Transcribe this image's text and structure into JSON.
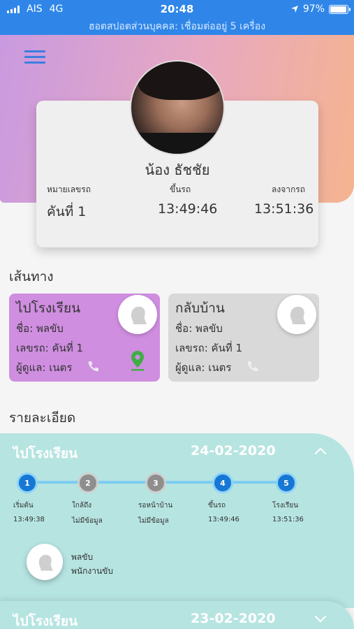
{
  "status": {
    "carrier": "AIS",
    "network": "4G",
    "time": "20:48",
    "battery": "97%",
    "battery_level": 0.97,
    "hotspot": "ฮอตสปอตส่วนบุคคล: เชื่อมต่ออยู่ 5 เครื่อง"
  },
  "profile": {
    "name": "น้อง ธัชชัย",
    "labels": {
      "bus_no": "หมายเลขรถ",
      "board": "ขึ้นรถ",
      "alight": "ลงจากรถ"
    },
    "values": {
      "bus_no": "คันที่ 1",
      "board": "13:49:46",
      "alight": "13:51:36"
    }
  },
  "routes_title": "เส้นทาง",
  "routes": [
    {
      "title": "ไปโรงเรียน",
      "name": "ชื่อ: พลขับ",
      "bus": "เลขรถ: คันที่ 1",
      "caretaker": "ผู้ดูแล: เนตร",
      "color": "#cf8ee0"
    },
    {
      "title": "กลับบ้าน",
      "name": "ชื่อ: พลขับ",
      "bus": "เลขรถ: คันที่ 1",
      "caretaker": "ผู้ดูแล: เนตร",
      "color": "#d9d9d9"
    }
  ],
  "details_title": "รายละเอียด",
  "detail": {
    "title": "ไปโรงเรียน",
    "date": "24-02-2020",
    "steps": [
      {
        "num": "1",
        "label": "เริ่มต้น",
        "time": "13:49:38",
        "state": "done"
      },
      {
        "num": "2",
        "label": "ใกล้ถึง",
        "time": "ไม่มีข้อมูล",
        "state": "none"
      },
      {
        "num": "3",
        "label": "รอหน้าบ้าน",
        "time": "ไม่มีข้อมูล",
        "state": "none"
      },
      {
        "num": "4",
        "label": "ขึ้นรถ",
        "time": "13:49:46",
        "state": "done"
      },
      {
        "num": "5",
        "label": "โรงเรียน",
        "time": "13:51:36",
        "state": "done"
      }
    ],
    "staff_name": "พลขับ",
    "staff_role": "พนักงานขับ"
  },
  "detail2": {
    "title": "ไปโรงเรียน",
    "date": "23-02-2020"
  },
  "colors": {
    "accent": "#2f86e8",
    "step_done": "#1677d4",
    "detail_bg": "#b6e4e1"
  }
}
